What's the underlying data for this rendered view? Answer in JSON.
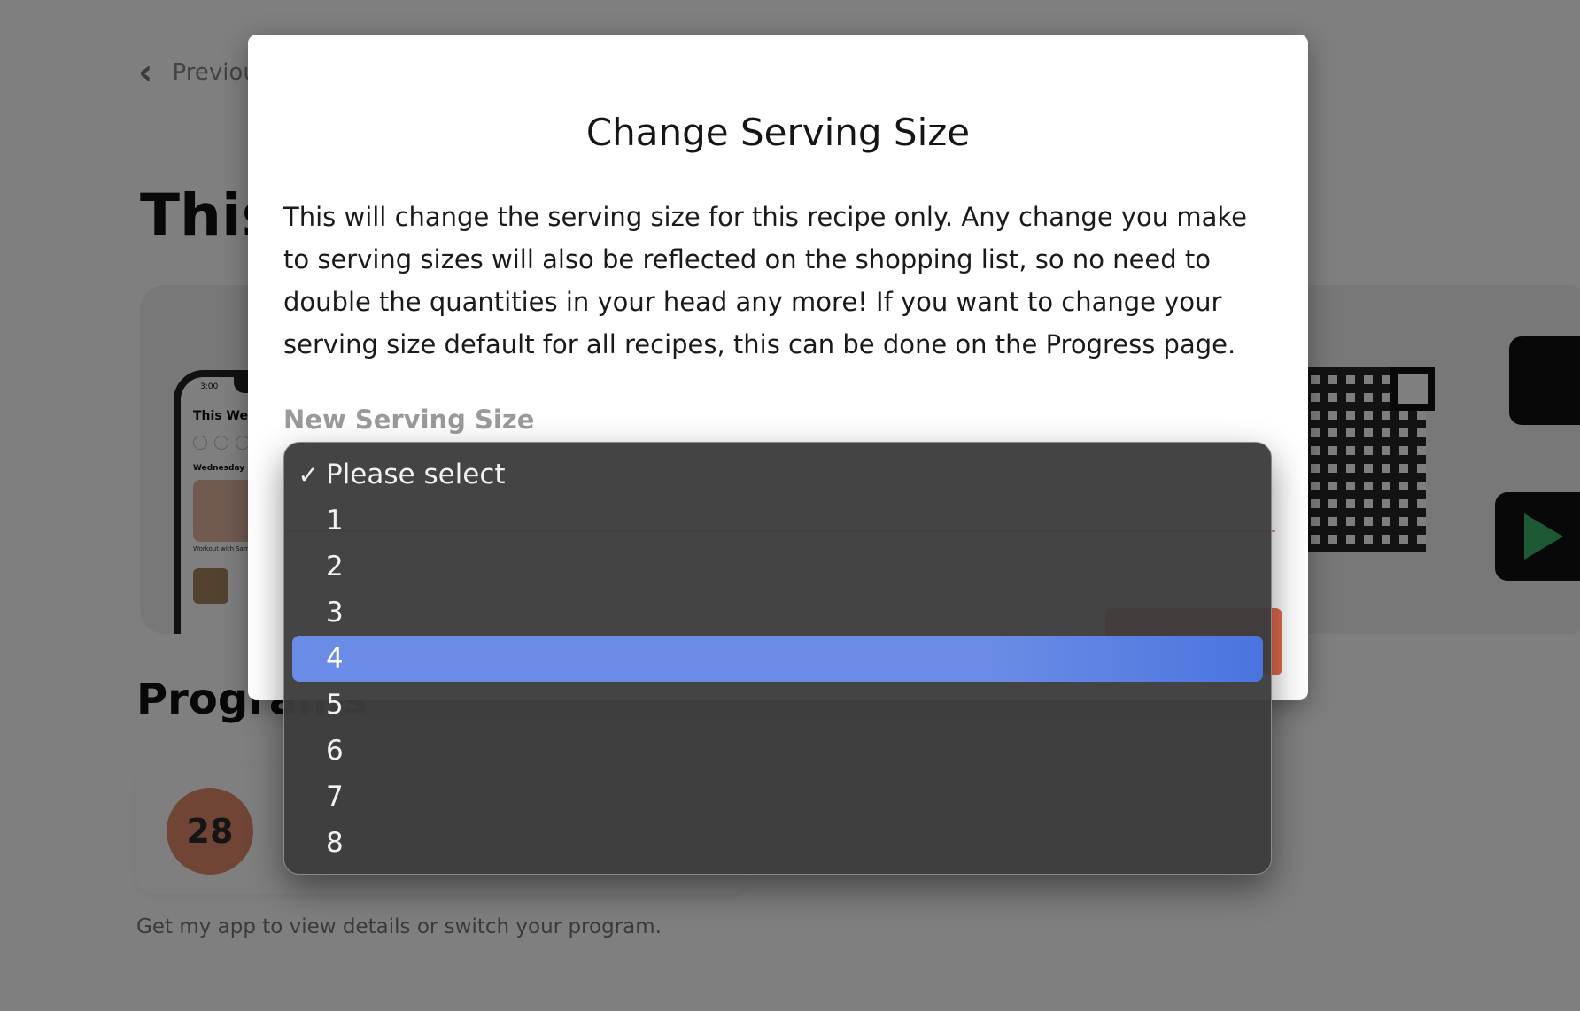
{
  "background": {
    "back_label": "Previous",
    "heading": "This Week",
    "phone": {
      "time": "3:00",
      "title": "This Week",
      "day": "Wednesday",
      "caption": "Workout with Sam"
    },
    "programs_title": "Programs",
    "program_number": "28",
    "footer_note": "Get my app to view details or switch your program."
  },
  "modal": {
    "title": "Change Serving Size",
    "body": "This will change the serving size for this recipe only. Any change you make to serving sizes will also be reflected on the shopping list, so no need to double the quantities in your head any more! If you want to change your serving size default for all recipes, this can be done on the Progress page.",
    "field_label": "New Serving Size"
  },
  "dropdown": {
    "options": [
      "Please select",
      "1",
      "2",
      "3",
      "4",
      "5",
      "6",
      "7",
      "8"
    ],
    "checked_option": "Please select",
    "highlighted_option": "4"
  },
  "colors": {
    "accent": "#e06a4c",
    "highlight": "#6a8ce6",
    "dropdown_bg": "#3c3c3c"
  },
  "icons": {
    "back": "chevron-left-icon",
    "apple": "apple-icon",
    "play": "google-play-icon",
    "check": "checkmark-icon"
  }
}
